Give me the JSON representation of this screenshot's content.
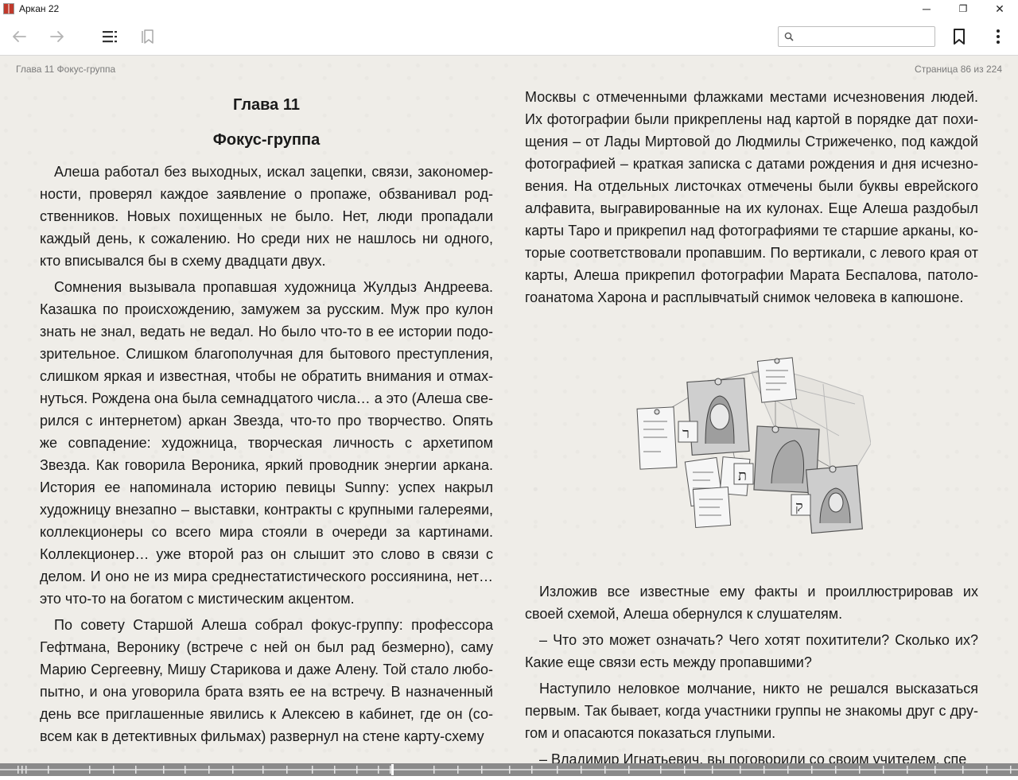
{
  "window": {
    "title": "Аркан 22",
    "minimize": "─",
    "maximize": "❐",
    "close": "✕"
  },
  "toolbar": {
    "back_icon": "arrow-left-icon",
    "forward_icon": "arrow-right-icon",
    "toc_icon": "table-of-contents-icon",
    "bookmarks_icon": "bookmarks-list-icon",
    "search_placeholder": "",
    "search_value": "",
    "bookmark_icon": "bookmark-icon",
    "menu_icon": "more-vertical-icon"
  },
  "header": {
    "chapter": "Глава 11 Фокус-группа",
    "page": "Страница 86 из 224"
  },
  "left_page": {
    "chapter_number": "Глава 11",
    "chapter_title": "Фокус-группа",
    "paragraphs": [
      "Алеша работал без выходных, искал зацепки, связи, закономер­ности, проверял каждое заявление о пропаже, обзванивал род­ственников. Новых похищенных не было. Нет, люди пропадали каждый день, к сожалению. Но среди них не нашлось ни одного, кто вписывался бы в схему двадцати двух.",
      "Сомнения вызывала пропавшая художница Жулдыз Андреева. Казашка по происхождению, замужем за русским. Муж про кулон знать не знал, ведать не ведал. Но было что-то в ее истории подо­зрительное. Слишком благополучная для бытового преступления, слишком яркая и известная, чтобы не обратить внимания и отмах­нуться. Рождена она была семнадцатого числа… а это (Алеша све­рился с интернетом) аркан Звезда, что-то про творчество. Опять же совпадение: художница, творческая личность с архетипом Звезда. Как говорила Вероника, яркий проводник энергии аркана. История ее напоминала историю певицы Sunny: успех накрыл художницу внезапно – выставки, контракты с крупными галереями, коллекцио­неры со всего мира стояли в очереди за картинами. Коллекцио­нер… уже второй раз он слышит это слово в связи с делом. И оно не из мира среднестатистического россиянина, нет… это что-то на богатом с мистическим акцентом.",
      "По совету Старшой Алеша собрал фокус-группу: профессора Гефтмана, Веронику (встрече с ней он был рад безмерно), саму Марию Сергеевну, Мишу Старикова и даже Алену. Той стало любо­пытно, и она уговорила брата взять ее на встречу. В назначенный день все приглашенные явились к Алексею в кабинет, где он (со­всем как в детективных фильмах) развернул на стене карту-схему"
    ]
  },
  "right_page": {
    "continuation": "Москвы с отмеченными флажками местами исчезновения людей. Их фотографии были прикреплены над картой в порядке дат похи­щения – от Лады Миртовой до Людмилы Стрижеченко, под каждой фотографией – краткая записка с датами рождения и дня исчезно­вения. На отдельных листочках отмечены были буквы еврейского алфавита, выгравированные на их кулонах. Еще Алеша раздобыл карты Таро и прикрепил над фотографиями те старшие арканы, ко­торые соответствовали пропавшим. По вертикали, с левого края от карты, Алеша прикрепил фотографии Марата Беспалова, патоло­гоанатома Харона и расплывчатый снимок человека в капюшоне.",
    "illustration": {
      "letters": [
        "ר",
        "ת",
        "ק"
      ]
    },
    "paragraphs": [
      "Изложив все известные ему факты и проиллюстрировав их своей схемой, Алеша обернулся к слушателям.",
      "– Что это может означать? Чего хотят похитители? Сколько их? Какие еще связи есть между пропавшими?",
      "Наступило неловкое молчание, никто не решался высказаться первым. Так бывает, когда участники группы не знакомы друг с дру­гом и опасаются показаться глупыми.",
      "– Владимир Игнатьевич, вы поговорили со своим учителем, спе­"
    ]
  },
  "progress": {
    "fraction": 0.384
  }
}
